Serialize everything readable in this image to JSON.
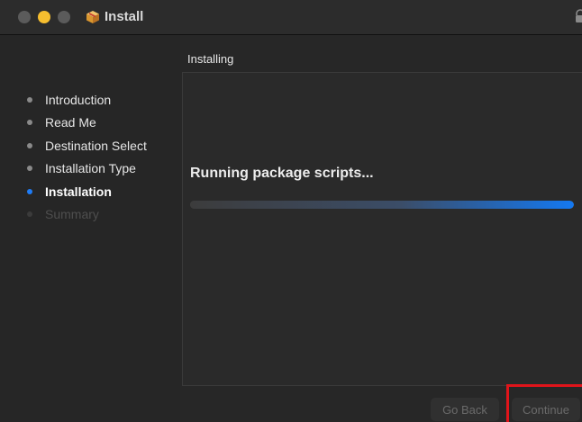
{
  "window": {
    "title": "Install",
    "app_icon": "package-icon",
    "lock_icon": "lock-icon"
  },
  "sidebar": {
    "items": [
      {
        "label": "Introduction",
        "state": "done"
      },
      {
        "label": "Read Me",
        "state": "done"
      },
      {
        "label": "Destination Select",
        "state": "done"
      },
      {
        "label": "Installation Type",
        "state": "done"
      },
      {
        "label": "Installation",
        "state": "active"
      },
      {
        "label": "Summary",
        "state": "pending"
      }
    ]
  },
  "main": {
    "section_title": "Installing",
    "status_text": "Running package scripts...",
    "progress_percent": 100
  },
  "buttons": {
    "back_label": "Go Back",
    "continue_label": "Continue"
  },
  "colors": {
    "accent": "#1f7cf6",
    "highlight": "#e0141a",
    "minimize": "#f6be2f"
  }
}
